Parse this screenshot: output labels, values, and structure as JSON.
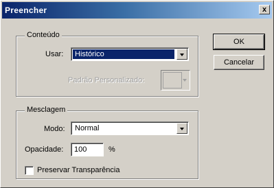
{
  "window": {
    "title": "Preencher",
    "close_label": "x"
  },
  "contents": {
    "legend": "Conteúdo",
    "use_label": "Usar:",
    "use_value": "Histórico",
    "custom_pattern_label": "Padrão Personalizado:"
  },
  "blending": {
    "legend": "Mesclagem",
    "mode_label": "Modo:",
    "mode_value": "Normal",
    "opacity_label": "Opacidade:",
    "opacity_value": "100",
    "opacity_unit": "%",
    "preserve_label": "Preservar Transparência",
    "preserve_checked": false
  },
  "buttons": {
    "ok": "OK",
    "cancel": "Cancelar"
  }
}
